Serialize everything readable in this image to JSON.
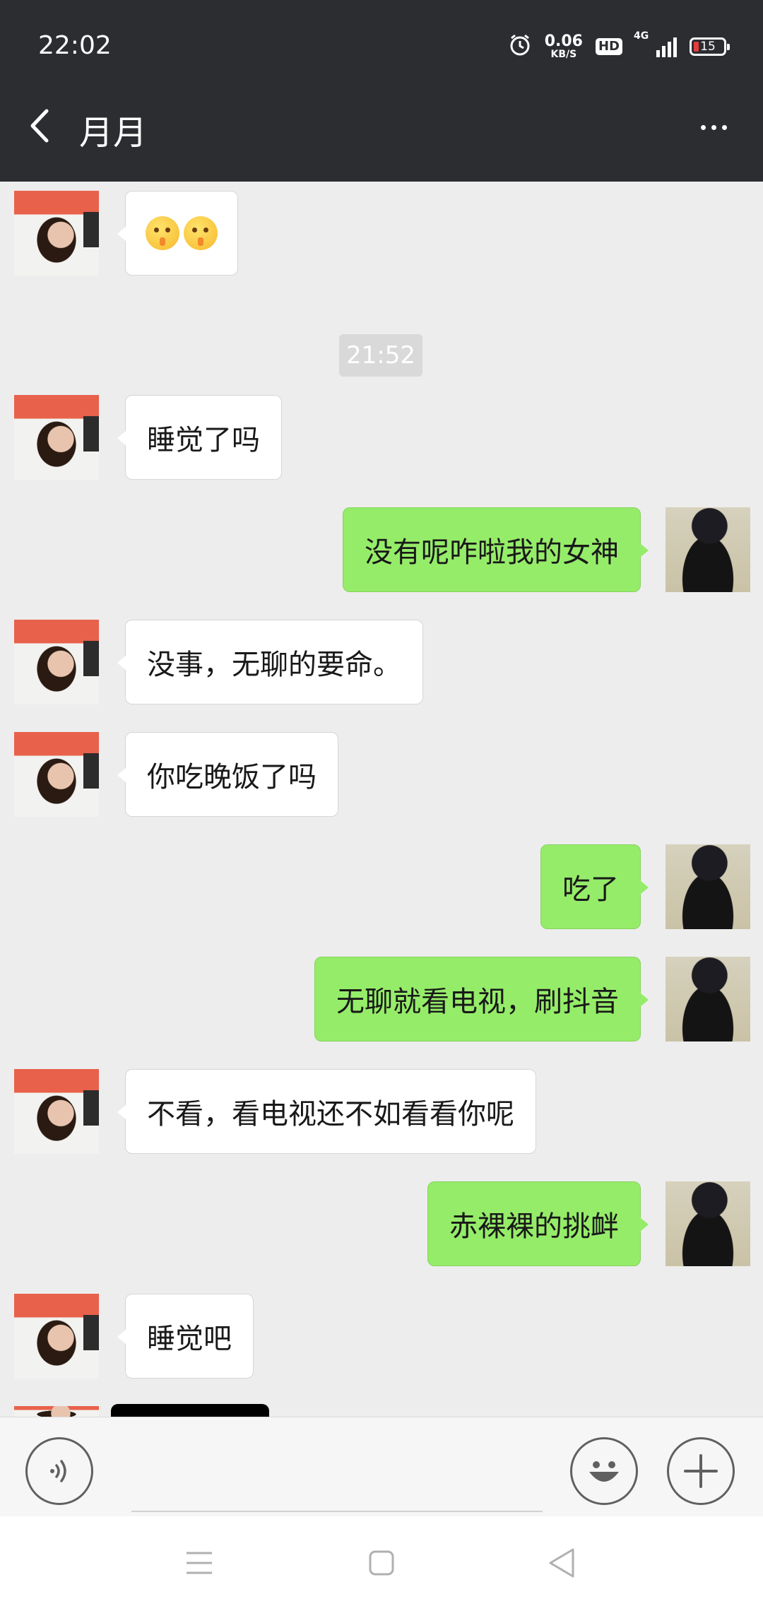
{
  "status_bar": {
    "time": "22:02",
    "net_speed_value": "0.06",
    "net_speed_unit": "KB/S",
    "hd": "HD",
    "network": "4G",
    "battery": "15",
    "icons": [
      "alarm-icon",
      "hd-icon",
      "signal-icon",
      "battery-icon"
    ]
  },
  "header": {
    "title": "月月",
    "back_icon": "chevron-left-icon",
    "more_icon": "more-dots-icon"
  },
  "chat": {
    "timestamp": "21:52",
    "messages": [
      {
        "side": "in",
        "text": "",
        "emoji": [
          "shushing-face",
          "shushing-face"
        ]
      },
      {
        "side": "in",
        "text": "睡觉了吗"
      },
      {
        "side": "out",
        "text": "没有呢咋啦我的女神"
      },
      {
        "side": "in",
        "text": "没事，无聊的要命。"
      },
      {
        "side": "in",
        "text": "你吃晚饭了吗"
      },
      {
        "side": "out",
        "text": "吃了"
      },
      {
        "side": "out",
        "text": "无聊就看电视，刷抖音"
      },
      {
        "side": "in",
        "text": "不看，看电视还不如看看你呢"
      },
      {
        "side": "out",
        "text": "赤裸裸的挑衅"
      },
      {
        "side": "in",
        "text": "睡觉吧"
      }
    ]
  },
  "input_bar": {
    "icons": [
      "voice-icon",
      "emoji-icon",
      "plus-icon"
    ]
  },
  "nav_bar": {
    "icons": [
      "menu-icon",
      "home-square-icon",
      "back-triangle-icon"
    ]
  },
  "colors": {
    "header_bg": "#2b2d31",
    "chat_bg": "#ededed",
    "outgoing_bubble": "#95ec69",
    "incoming_bubble": "#ffffff"
  }
}
